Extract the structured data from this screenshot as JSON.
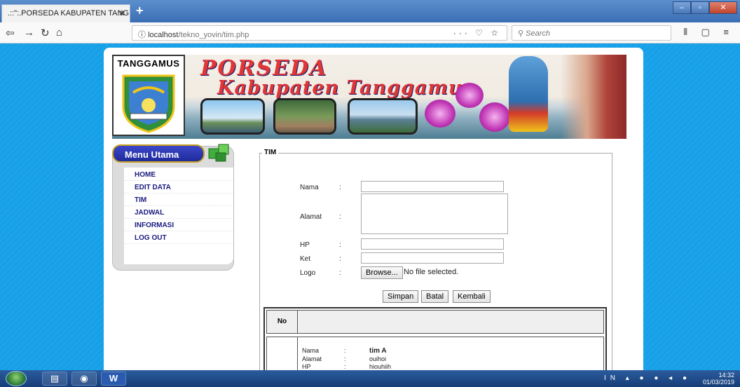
{
  "browser": {
    "tab_title": ".::\":.PORSEDA KABUPATEN TANG",
    "tab_close": "✕",
    "new_tab": "+",
    "url_host": "localhost",
    "url_path": "/tekno_yovin/tim.php",
    "url_actions": "··· ♡ ☆",
    "search_placeholder": "Search"
  },
  "banner": {
    "emblem_label": "TANGGAMUS",
    "title_line1": "PORSEDA",
    "title_line2": "Kabupaten Tanggamus"
  },
  "sidebar": {
    "header": "Menu Utama",
    "items": [
      {
        "label": "HOME"
      },
      {
        "label": "EDIT DATA"
      },
      {
        "label": "TIM"
      },
      {
        "label": "JADWAL"
      },
      {
        "label": "INFORMASI"
      },
      {
        "label": "LOG OUT"
      }
    ]
  },
  "form": {
    "legend": "TIM",
    "labels": {
      "nama": "Nama",
      "alamat": "Alamat",
      "hp": "HP",
      "ket": "Ket",
      "logo": "Logo"
    },
    "colon": ":",
    "browse_label": "Browse...",
    "no_file": "No file selected.",
    "buttons": {
      "simpan": "Simpan",
      "batal": "Batal",
      "kembali": "Kembali"
    }
  },
  "table": {
    "header_no": "No",
    "rows": [
      {
        "nama_label": "Nama",
        "nama": "tim A",
        "alamat_label": "Alamat",
        "alamat": "ouihoi",
        "hp_label": "HP",
        "hp": "hiouhiih"
      }
    ]
  },
  "taskbar": {
    "lang": "IN",
    "time": "14:32",
    "date": "01/03/2019",
    "word_label": "W"
  }
}
